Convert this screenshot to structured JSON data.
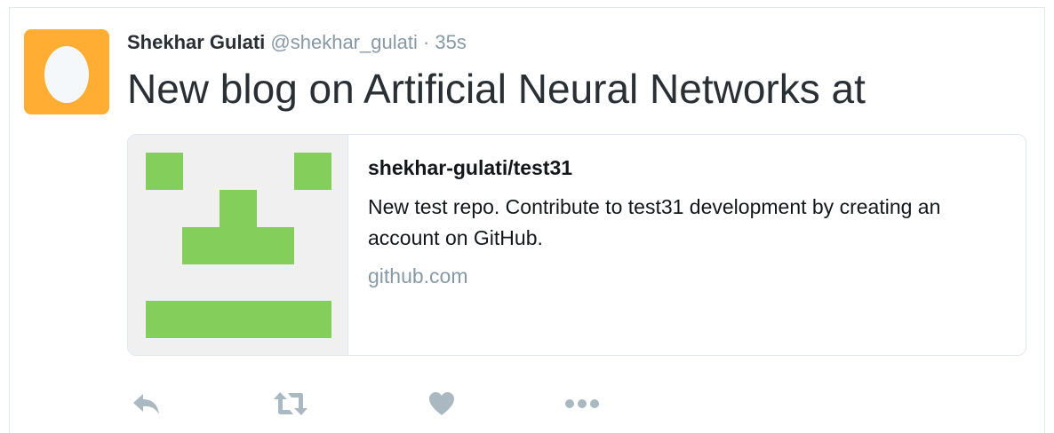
{
  "tweet": {
    "author": {
      "fullname": "Shekhar Gulati",
      "username": "@shekhar_gulati",
      "separator": "·",
      "timestamp": "35s",
      "avatar_icon": "egg-avatar-icon",
      "avatar_color": "#ffad33"
    },
    "text": "New blog on Artificial Neural Networks at",
    "card": {
      "image_icon": "github-identicon",
      "identicon_color": "#84ce5b",
      "title": "shekhar-gulati/test31",
      "description": "New test repo. Contribute to test31 development by creating an account on GitHub.",
      "domain": "github.com"
    },
    "actions": {
      "reply_icon": "reply-icon",
      "retweet_icon": "retweet-icon",
      "like_icon": "heart-icon",
      "more_icon": "more-dots-icon",
      "icon_color": "#aab8c2"
    }
  }
}
